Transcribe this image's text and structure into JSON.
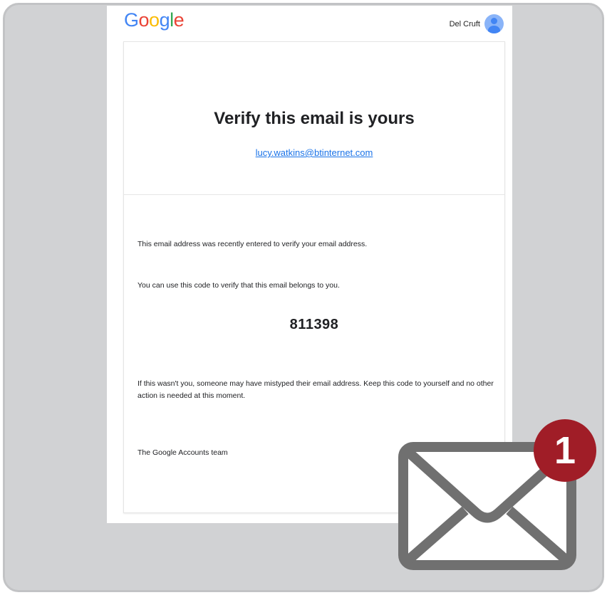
{
  "header": {
    "logo_letters": [
      {
        "char": "G",
        "color": "#4285f4"
      },
      {
        "char": "o",
        "color": "#ea4335"
      },
      {
        "char": "o",
        "color": "#fbbc05"
      },
      {
        "char": "g",
        "color": "#4285f4"
      },
      {
        "char": "l",
        "color": "#34a853"
      },
      {
        "char": "e",
        "color": "#ea4335"
      }
    ],
    "account_name": "Del Cruft",
    "avatar_icon": "person-avatar-icon"
  },
  "email": {
    "title": "Verify this email is yours",
    "address": "lucy.watkins@btinternet.com",
    "paragraph_1": "This email address was recently entered to verify your email address.",
    "paragraph_2": "You can use this code to verify that this email belongs to you.",
    "code": "811398",
    "paragraph_3": "If this wasn't you, someone may have mistyped their email address. Keep this code to yourself and no other action is needed at this moment.",
    "signature": "The Google Accounts team"
  },
  "notification": {
    "icon": "envelope-icon",
    "count": "1",
    "badge_color": "#a01d27"
  }
}
